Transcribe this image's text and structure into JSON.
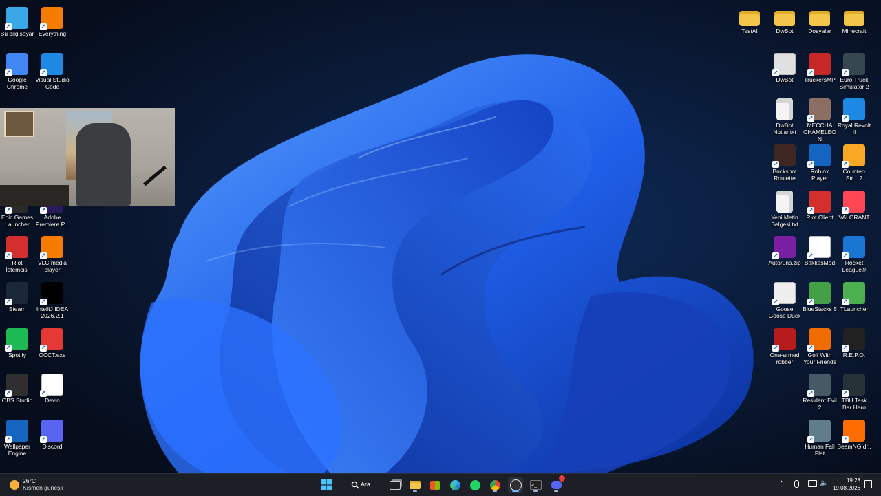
{
  "desktop": {
    "left_icons": [
      {
        "label": "Bu bilgisayar",
        "icon": "this-pc-icon",
        "color": "#3aa7e8"
      },
      {
        "label": "Everything",
        "icon": "everything-icon",
        "color": "#f57c00"
      },
      {
        "label": "Google Chrome",
        "icon": "chrome-icon",
        "color": "#4285f4"
      },
      {
        "label": "Visual Studio Code",
        "icon": "vscode-icon",
        "color": "#1e88e5"
      },
      {
        "label": "Epic Games Launcher",
        "icon": "epic-games-icon",
        "color": "#2a2a2a"
      },
      {
        "label": "Adobe Premiere P...",
        "icon": "premiere-icon",
        "color": "#2a1a5e"
      },
      {
        "label": "Riot İstemcisi",
        "icon": "riot-icon",
        "color": "#d32f2f"
      },
      {
        "label": "VLC media player",
        "icon": "vlc-icon",
        "color": "#f57c00"
      },
      {
        "label": "Steam",
        "icon": "steam-icon",
        "color": "#1b2838"
      },
      {
        "label": "IntelliJ IDEA 2026.2.1",
        "icon": "intellij-icon",
        "color": "#000000"
      },
      {
        "label": "Spotify",
        "icon": "spotify-icon",
        "color": "#1db954"
      },
      {
        "label": "OCCT.exe",
        "icon": "occt-icon",
        "color": "#e53935"
      },
      {
        "label": "OBS Studio",
        "icon": "obs-icon",
        "color": "#302e31"
      },
      {
        "label": "Devin",
        "icon": "devin-icon",
        "color": "#ffffff"
      },
      {
        "label": "Wallpaper Engine",
        "icon": "wallpaper-engine-icon",
        "color": "#1565c0"
      },
      {
        "label": "Discord",
        "icon": "discord-icon",
        "color": "#5865f2"
      }
    ],
    "right_icons": [
      {
        "label": "TestAI",
        "icon": "folder-icon",
        "type": "folder"
      },
      {
        "label": "DwBot",
        "icon": "folder-icon",
        "type": "folder"
      },
      {
        "label": "Dosyalar",
        "icon": "folder-icon",
        "type": "folder"
      },
      {
        "label": "Minecraft",
        "icon": "folder-icon",
        "type": "folder"
      },
      {
        "label": "DwBot",
        "icon": "settings-file-icon",
        "color": "#e0e0e0"
      },
      {
        "label": "TruckersMP",
        "icon": "truckersmp-icon",
        "color": "#c62828"
      },
      {
        "label": "Euro Truck Simulator 2",
        "icon": "ets2-icon",
        "color": "#37474f"
      },
      {
        "label": "DwBot Notlar.txt",
        "icon": "text-file-icon",
        "type": "doc"
      },
      {
        "label": "MECCHA CHAMELEON",
        "icon": "meccha-chameleon-icon",
        "color": "#8d6e63"
      },
      {
        "label": "Royal Revolt II",
        "icon": "royal-revolt-icon",
        "color": "#1e88e5"
      },
      {
        "label": "Buckshot Roulette",
        "icon": "buckshot-roulette-icon",
        "color": "#3e2723"
      },
      {
        "label": "Roblox Player",
        "icon": "roblox-icon",
        "color": "#1565c0"
      },
      {
        "label": "Counter-Str... 2",
        "icon": "cs2-icon",
        "color": "#f9a825"
      },
      {
        "label": "Yeni Metin Belgesi.txt",
        "icon": "text-file-icon",
        "type": "doc"
      },
      {
        "label": "Riot Client",
        "icon": "riot-icon",
        "color": "#d32f2f"
      },
      {
        "label": "VALORANT",
        "icon": "valorant-icon",
        "color": "#ff4655"
      },
      {
        "label": "Autoruns.zip",
        "icon": "winrar-icon",
        "color": "#7b1fa2"
      },
      {
        "label": "BakkesMod",
        "icon": "bakkesmod-icon",
        "color": "#ffffff"
      },
      {
        "label": "Rocket League®",
        "icon": "rocket-league-icon",
        "color": "#1976d2"
      },
      {
        "label": "Goose Goose Duck",
        "icon": "goose-goose-duck-icon",
        "color": "#eeeeee"
      },
      {
        "label": "BlueStacks 5",
        "icon": "bluestacks-icon",
        "color": "#43a047"
      },
      {
        "label": "TLauncher",
        "icon": "tlauncher-icon",
        "color": "#4caf50"
      },
      {
        "label": "One-armed robber",
        "icon": "one-armed-robber-icon",
        "color": "#b71c1c"
      },
      {
        "label": "Golf With Your Friends",
        "icon": "golf-with-friends-icon",
        "color": "#ef6c00"
      },
      {
        "label": "R.E.P.O.",
        "icon": "repo-icon",
        "color": "#212121"
      },
      {
        "label": "Resident Evil 2",
        "icon": "resident-evil-icon",
        "color": "#455a64"
      },
      {
        "label": "TBH Task Bar Hero",
        "icon": "tbh-icon",
        "color": "#263238"
      },
      {
        "label": "Human Fall Flat",
        "icon": "human-fall-flat-icon",
        "color": "#607d8b"
      },
      {
        "label": "BeamNG.dr...",
        "icon": "beamng-icon",
        "color": "#ff6d00"
      }
    ]
  },
  "taskbar": {
    "weather_temp": "26°C",
    "weather_desc": "Kısmen güneşli",
    "search_label": "Ara",
    "time": "19:28",
    "date": "19.08.2026",
    "discord_badge": "1",
    "apps": [
      {
        "name": "start-button",
        "icon": "windows-icon"
      },
      {
        "name": "search",
        "icon": "search-icon"
      },
      {
        "name": "task-view",
        "icon": "task-view-icon"
      },
      {
        "name": "file-explorer",
        "icon": "folder-icon"
      },
      {
        "name": "microsoft-store",
        "icon": "store-icon"
      },
      {
        "name": "edge",
        "icon": "edge-icon"
      },
      {
        "name": "whatsapp",
        "icon": "whatsapp-icon"
      },
      {
        "name": "chrome",
        "icon": "chrome-icon"
      },
      {
        "name": "obs",
        "icon": "obs-icon"
      },
      {
        "name": "terminal",
        "icon": "terminal-icon"
      },
      {
        "name": "discord",
        "icon": "discord-icon"
      }
    ]
  }
}
